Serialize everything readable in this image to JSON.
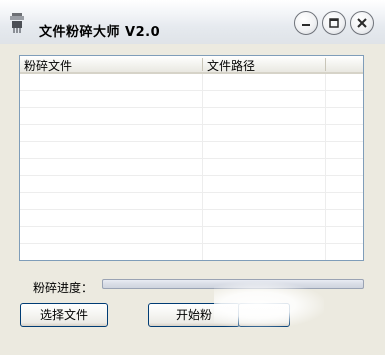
{
  "window": {
    "title": "文件粉碎大师 V2.0",
    "controls": {
      "minimize_icon": "minimize-icon",
      "maximize_icon": "maximize-icon",
      "close_icon": "close-icon"
    }
  },
  "file_list": {
    "columns": [
      "粉碎文件",
      "文件路径",
      ""
    ],
    "rows": []
  },
  "progress": {
    "label": "粉碎进度：",
    "value": 0
  },
  "buttons": {
    "select_file": "选择文件",
    "start": "开始粉",
    "third": ""
  },
  "colors": {
    "titlebar": "#e6eaef",
    "window_background": "#eceae0",
    "list_border": "#7f9db9",
    "button_border": "#003c74"
  }
}
